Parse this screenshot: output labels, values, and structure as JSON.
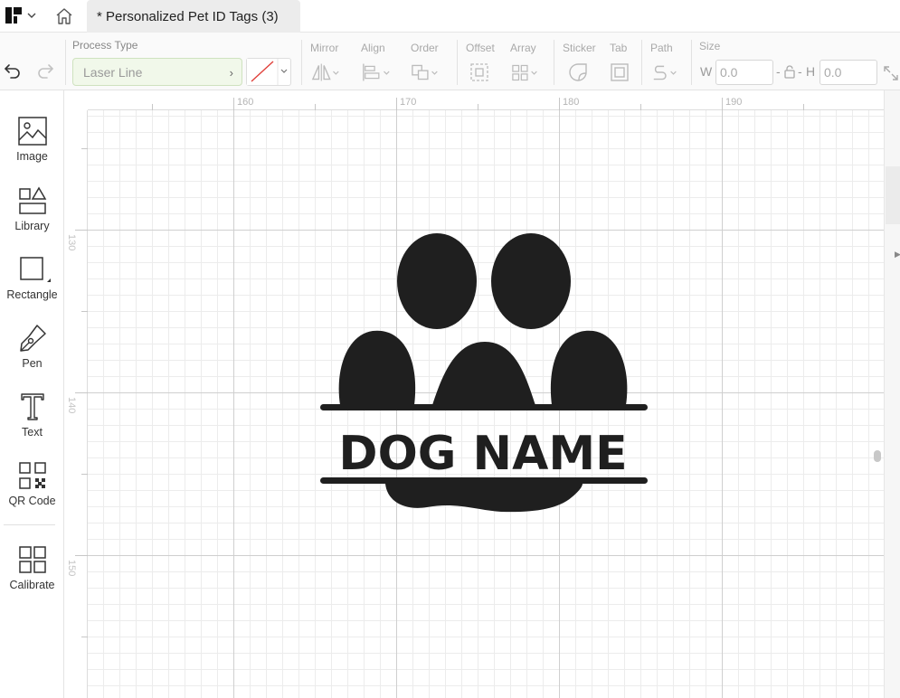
{
  "titlebar": {
    "logo_icon": "app-logo-icon",
    "home_icon": "home-icon",
    "document_tab": "* Personalized Pet ID Tags (3)"
  },
  "toolbar": {
    "undo_icon": "undo-icon",
    "redo_icon": "redo-icon",
    "process_type": {
      "label": "Process Type",
      "value": "Laser Line"
    },
    "line_color": "#e0403a",
    "groups": [
      {
        "label": "Mirror",
        "icon": "mirror-icon"
      },
      {
        "label": "Align",
        "icon": "align-icon"
      },
      {
        "label": "Order",
        "icon": "order-icon"
      },
      {
        "label": "Offset",
        "icon": "offset-icon"
      },
      {
        "label": "Array",
        "icon": "array-icon"
      },
      {
        "label": "Sticker",
        "icon": "sticker-icon"
      },
      {
        "label": "Tab",
        "icon": "tab-icon"
      },
      {
        "label": "Path",
        "icon": "path-icon"
      }
    ],
    "size": {
      "label": "Size",
      "width_letter": "W",
      "width_value": "0.0",
      "dash": "-",
      "height_letter": "H",
      "height_value": "0.0"
    }
  },
  "sidebar": {
    "items": [
      {
        "label": "Image",
        "icon": "image-icon"
      },
      {
        "label": "Library",
        "icon": "library-icon"
      },
      {
        "label": "Rectangle",
        "icon": "rectangle-icon"
      },
      {
        "label": "Pen",
        "icon": "pen-icon"
      },
      {
        "label": "Text",
        "icon": "text-icon"
      },
      {
        "label": "QR Code",
        "icon": "qr-code-icon"
      },
      {
        "label": "Calibrate",
        "icon": "calibrate-icon"
      }
    ]
  },
  "canvas": {
    "ruler_top": [
      "160",
      "170",
      "180",
      "190"
    ],
    "ruler_left": [
      "130",
      "140",
      "150"
    ],
    "design_text": "DOG NAME",
    "design_color": "#1f1f1f"
  }
}
